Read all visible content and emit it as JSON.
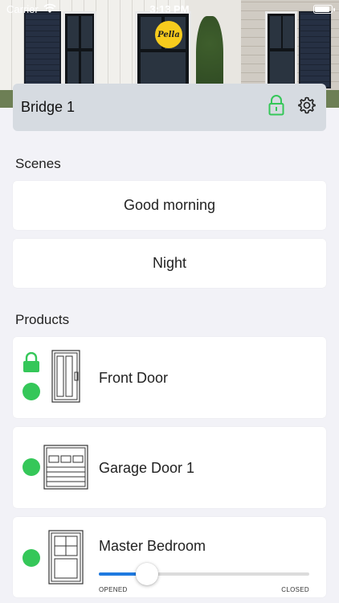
{
  "status_bar": {
    "carrier": "Carrier",
    "time": "3:13 PM",
    "icons": [
      "wifi-icon",
      "battery-icon"
    ]
  },
  "hero": {
    "logo_text": "Pella"
  },
  "bridge": {
    "title": "Bridge 1",
    "icons": [
      "lock-icon",
      "gear-icon"
    ],
    "lock_color": "#35c759"
  },
  "scenes": {
    "title": "Scenes",
    "items": [
      {
        "label": "Good morning"
      },
      {
        "label": "Night"
      }
    ]
  },
  "products": {
    "title": "Products",
    "items": [
      {
        "name": "Front Door",
        "thumb_icon": "door-icon",
        "locked": true,
        "status_color": "#35c759"
      },
      {
        "name": "Garage Door 1",
        "thumb_icon": "garage-door-icon",
        "status_color": "#35c759"
      },
      {
        "name": "Master Bedroom",
        "thumb_icon": "window-icon",
        "status_color": "#35c759",
        "slider": {
          "min_label": "OPENED",
          "max_label": "CLOSED",
          "value": 0.23
        }
      }
    ]
  },
  "colors": {
    "accent": "#1f7ae0",
    "status_green": "#35c759",
    "background": "#f2f2f7",
    "bridge_bar": "#d6dbe1"
  }
}
